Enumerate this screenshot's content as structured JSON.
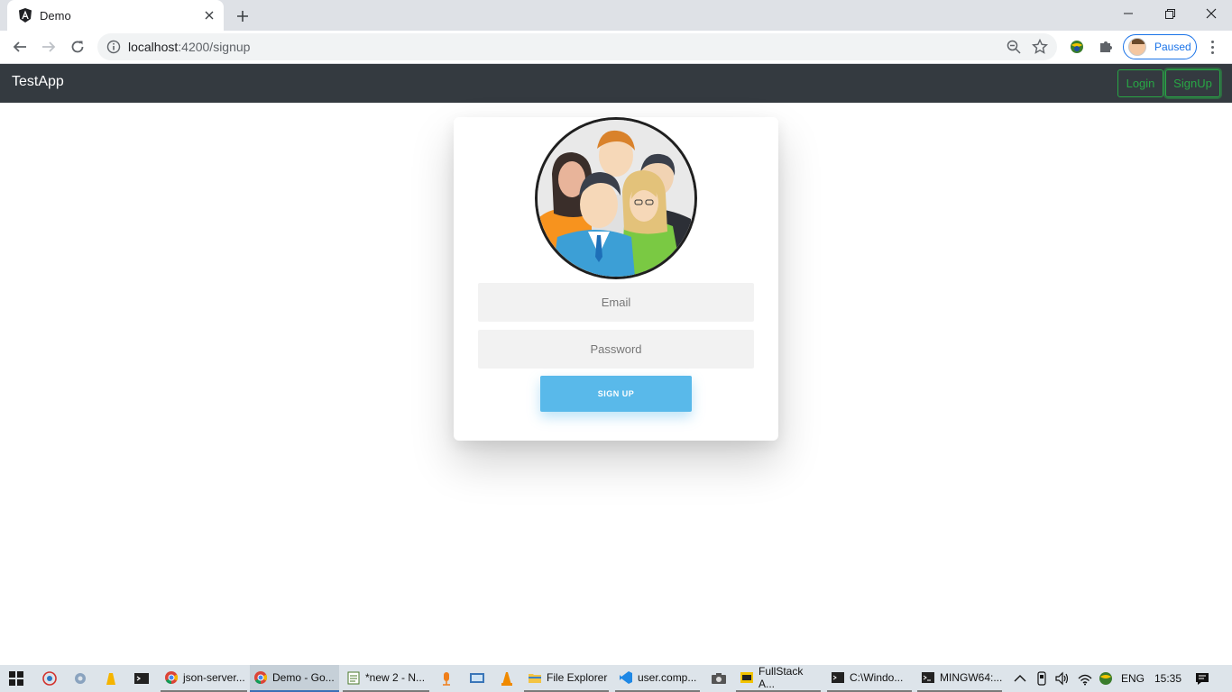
{
  "browser": {
    "tab_title": "Demo",
    "url_host": "localhost",
    "url_port_path": ":4200/signup",
    "profile_label": "Paused"
  },
  "app": {
    "brand": "TestApp",
    "nav_login": "Login",
    "nav_signup": "SignUp"
  },
  "form": {
    "email_placeholder": "Email",
    "password_placeholder": "Password",
    "submit_label": "SIGN UP"
  },
  "taskbar": {
    "apps": [
      "json-server...",
      "Demo - Go...",
      "*new 2 - N...",
      "File Explorer",
      "user.comp...",
      "FullStack A...",
      "C:\\Windo...",
      "MINGW64:..."
    ],
    "language": "ENG",
    "time": "15:35"
  },
  "colors": {
    "navbar_bg": "#343a40",
    "nav_button_green": "#28a745",
    "signup_button": "#59b9ea",
    "tabbar_bg": "#dee1e6"
  },
  "icons": [
    "angular-favicon-icon",
    "close-icon",
    "plus-icon",
    "back-arrow-icon",
    "forward-arrow-icon",
    "reload-icon",
    "info-icon",
    "zoom-icon",
    "star-icon",
    "extension-icon",
    "puzzle-icon",
    "kebab-menu-icon",
    "windows-start-icon"
  ]
}
